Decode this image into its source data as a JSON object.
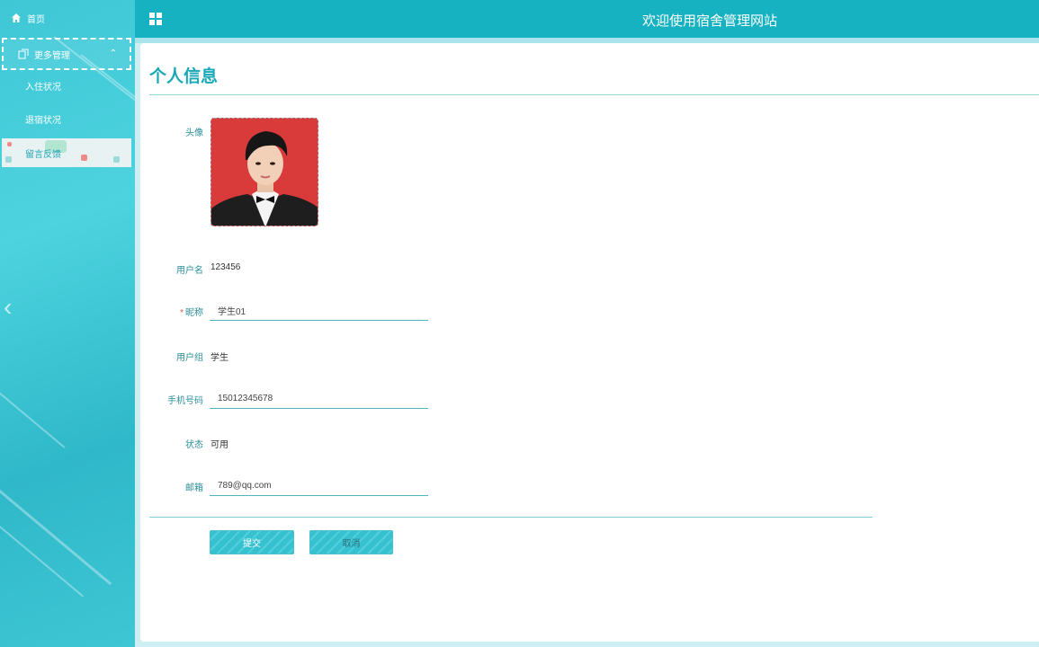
{
  "sidebar": {
    "home_label": "首页",
    "more_label": "更多管理",
    "items": [
      {
        "label": "入住状况"
      },
      {
        "label": "退宿状况"
      },
      {
        "label": "留言反馈"
      }
    ],
    "icons": {
      "home": "home-icon",
      "more": "copy-icon",
      "chevron": "chevron-up-icon",
      "collapse": "chevron-left-icon"
    }
  },
  "header": {
    "title": "欢迎使用宿舍管理网站",
    "menu_icon": "grid-icon"
  },
  "page": {
    "title": "个人信息"
  },
  "form": {
    "avatar_label": "头像",
    "username_label": "用户名",
    "username_value": "123456",
    "nickname_label": "昵称",
    "nickname_required": "*",
    "nickname_value": "学生01",
    "group_label": "用户组",
    "group_value": "学生",
    "phone_label": "手机号码",
    "phone_value": "15012345678",
    "status_label": "状态",
    "status_value": "可用",
    "email_label": "邮箱",
    "email_value": "789@qq.com",
    "submit_label": "提交",
    "cancel_label": "取消"
  },
  "colors": {
    "accent": "#17b2c2",
    "title": "#19a8b8",
    "label": "#2a8e99",
    "avatar_bg": "#d93a3a"
  }
}
